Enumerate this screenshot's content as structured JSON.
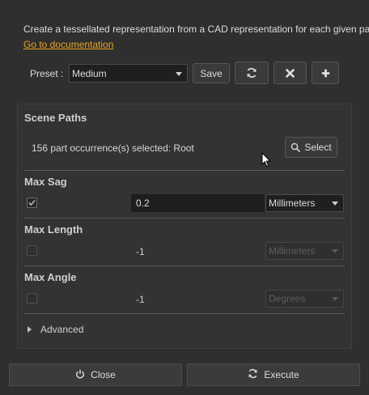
{
  "description": "Create a tessellated representation from a CAD representation for each given part",
  "doc_link": "Go to documentation",
  "preset": {
    "label": "Preset :",
    "value": "Medium",
    "save_label": "Save"
  },
  "scene_paths": {
    "title": "Scene Paths",
    "selection_text": "156 part occurrence(s) selected: Root",
    "select_label": "Select"
  },
  "max_sag": {
    "title": "Max Sag",
    "checked": true,
    "value": "0.2",
    "unit": "Millimeters"
  },
  "max_length": {
    "title": "Max Length",
    "checked": false,
    "value": "-1",
    "unit": "Millimeters"
  },
  "max_angle": {
    "title": "Max Angle",
    "checked": false,
    "value": "-1",
    "unit": "Degrees"
  },
  "advanced": {
    "label": "Advanced"
  },
  "footer": {
    "close_label": "Close",
    "execute_label": "Execute"
  },
  "colors": {
    "background": "#2f2f2f",
    "link": "#e8a317",
    "input_bg": "#1e1e1e"
  }
}
